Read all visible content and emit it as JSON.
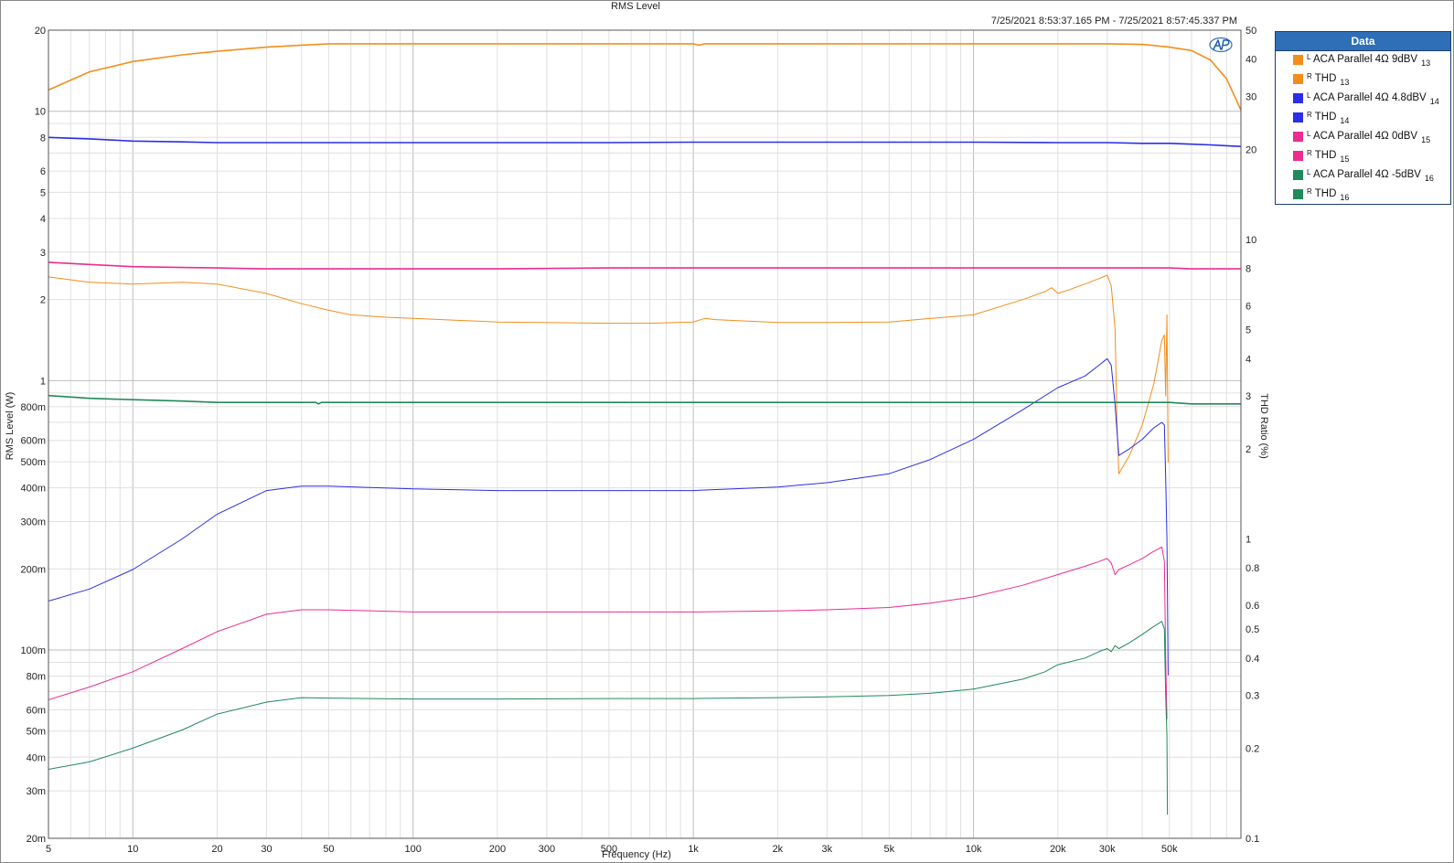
{
  "chart_data": {
    "type": "line",
    "title": "RMS Level",
    "subtitle": "7/25/2021 8:53:37.165 PM - 7/25/2021 8:57:45.337 PM",
    "xlabel": "Frequency (Hz)",
    "ylabel": "RMS Level (W)",
    "y2label": "THD Ratio (%)",
    "xscale": "log",
    "yscale": "log",
    "y2scale": "log",
    "xlim": [
      5,
      90000
    ],
    "ylim": [
      0.02,
      20
    ],
    "y2lim": [
      0.1,
      50
    ],
    "grid": true,
    "legend_position": "right",
    "x_tick_labels": [
      "5",
      "10",
      "20",
      "30",
      "50",
      "100",
      "200",
      "300",
      "500",
      "1k",
      "2k",
      "3k",
      "5k",
      "10k",
      "20k",
      "30k",
      "50k"
    ],
    "x_tick_values": [
      5,
      10,
      20,
      30,
      50,
      100,
      200,
      300,
      500,
      1000,
      2000,
      3000,
      5000,
      10000,
      20000,
      30000,
      50000
    ],
    "y_tick_labels": [
      "20",
      "10",
      "8",
      "6",
      "5",
      "4",
      "3",
      "2",
      "1",
      "800m",
      "600m",
      "500m",
      "400m",
      "300m",
      "200m",
      "100m",
      "80m",
      "60m",
      "50m",
      "40m",
      "30m",
      "20m"
    ],
    "y_tick_values": [
      20,
      10,
      8,
      6,
      5,
      4,
      3,
      2,
      1,
      0.8,
      0.6,
      0.5,
      0.4,
      0.3,
      0.2,
      0.1,
      0.08,
      0.06,
      0.05,
      0.04,
      0.03,
      0.02
    ],
    "y2_tick_labels": [
      "50",
      "40",
      "30",
      "20",
      "10",
      "8",
      "6",
      "5",
      "4",
      "3",
      "2",
      "1",
      "0.8",
      "0.6",
      "0.5",
      "0.4",
      "0.3",
      "0.2",
      "0.1"
    ],
    "y2_tick_values": [
      50,
      40,
      30,
      20,
      10,
      8,
      6,
      5,
      4,
      3,
      2,
      1,
      0.8,
      0.6,
      0.5,
      0.4,
      0.3,
      0.2,
      0.1
    ],
    "legend_title": "Data",
    "series": [
      {
        "name": "ACA Parallel 4Ω 9dBV",
        "channel": "L",
        "index": "13",
        "color": "#f28e1c",
        "axis": "left",
        "width": 1.6,
        "x": [
          5,
          7,
          10,
          15,
          20,
          30,
          40,
          50,
          100,
          200,
          500,
          1000,
          1050,
          1100,
          2000,
          5000,
          10000,
          20000,
          30000,
          40000,
          45000,
          50000,
          60000,
          70000,
          80000,
          90000
        ],
        "y": [
          12.0,
          14.0,
          15.3,
          16.2,
          16.7,
          17.3,
          17.6,
          17.8,
          17.8,
          17.8,
          17.8,
          17.8,
          17.6,
          17.8,
          17.8,
          17.8,
          17.8,
          17.8,
          17.8,
          17.7,
          17.5,
          17.3,
          16.8,
          15.5,
          13.2,
          10.1
        ]
      },
      {
        "name": "THD",
        "channel": "R",
        "index": "13",
        "color": "#f28e1c",
        "axis": "right",
        "width": 1.0,
        "x": [
          5,
          7,
          10,
          15,
          20,
          30,
          40,
          50,
          60,
          80,
          100,
          200,
          500,
          700,
          1000,
          1100,
          1200,
          2000,
          3000,
          5000,
          10000,
          15000,
          18000,
          19000,
          20000,
          22000,
          25000,
          28000,
          30000,
          31000,
          32000,
          32500,
          33000,
          36000,
          40000,
          44000,
          47000,
          48000,
          48500,
          49000,
          49500
        ],
        "y": [
          7.5,
          7.2,
          7.1,
          7.2,
          7.1,
          6.6,
          6.1,
          5.8,
          5.6,
          5.5,
          5.45,
          5.3,
          5.25,
          5.25,
          5.3,
          5.45,
          5.4,
          5.28,
          5.28,
          5.3,
          5.6,
          6.3,
          6.7,
          6.9,
          6.6,
          6.8,
          7.1,
          7.4,
          7.6,
          7.0,
          5.0,
          2.5,
          1.65,
          1.9,
          2.4,
          3.3,
          4.6,
          4.8,
          3.0,
          5.6,
          1.8
        ]
      },
      {
        "name": "ACA Parallel 4Ω 4.8dBV",
        "channel": "L",
        "index": "14",
        "color": "#2b2ee6",
        "axis": "left",
        "width": 1.6,
        "x": [
          5,
          7,
          10,
          15,
          20,
          30,
          50,
          100,
          200,
          500,
          1000,
          2000,
          5000,
          10000,
          20000,
          30000,
          40000,
          50000,
          60000,
          70000,
          80000,
          90000
        ],
        "y": [
          8.0,
          7.9,
          7.75,
          7.7,
          7.65,
          7.65,
          7.65,
          7.65,
          7.65,
          7.65,
          7.68,
          7.68,
          7.68,
          7.68,
          7.65,
          7.65,
          7.6,
          7.6,
          7.55,
          7.5,
          7.45,
          7.4
        ]
      },
      {
        "name": "THD",
        "channel": "R",
        "index": "14",
        "color": "#2b2ee6",
        "axis": "right",
        "width": 1.0,
        "x": [
          5,
          7,
          10,
          15,
          20,
          30,
          40,
          50,
          100,
          200,
          500,
          1000,
          2000,
          3000,
          5000,
          7000,
          10000,
          15000,
          20000,
          25000,
          28000,
          30000,
          31000,
          32000,
          32500,
          33000,
          36000,
          40000,
          44000,
          47000,
          48000,
          48500,
          49000,
          49500
        ],
        "y": [
          0.62,
          0.68,
          0.79,
          1.0,
          1.21,
          1.45,
          1.5,
          1.5,
          1.47,
          1.45,
          1.45,
          1.45,
          1.49,
          1.54,
          1.65,
          1.84,
          2.15,
          2.7,
          3.2,
          3.5,
          3.8,
          4.0,
          3.8,
          2.8,
          2.3,
          1.9,
          2.0,
          2.15,
          2.35,
          2.45,
          2.4,
          1.6,
          1.0,
          0.35
        ]
      },
      {
        "name": "ACA Parallel 4Ω 0dBV",
        "channel": "L",
        "index": "15",
        "color": "#ec2c8f",
        "axis": "left",
        "width": 1.6,
        "x": [
          5,
          7,
          10,
          15,
          20,
          30,
          50,
          100,
          200,
          500,
          1000,
          2000,
          5000,
          10000,
          20000,
          30000,
          40000,
          50000,
          60000,
          70000,
          80000,
          90000
        ],
        "y": [
          2.75,
          2.7,
          2.65,
          2.63,
          2.62,
          2.6,
          2.6,
          2.6,
          2.6,
          2.62,
          2.62,
          2.62,
          2.62,
          2.62,
          2.62,
          2.62,
          2.62,
          2.62,
          2.6,
          2.6,
          2.6,
          2.6
        ]
      },
      {
        "name": "THD",
        "channel": "R",
        "index": "15",
        "color": "#ec2c8f",
        "axis": "right",
        "width": 1.0,
        "x": [
          5,
          7,
          10,
          15,
          20,
          30,
          40,
          50,
          100,
          200,
          500,
          1000,
          2000,
          3000,
          5000,
          7000,
          10000,
          15000,
          20000,
          25000,
          28000,
          30000,
          31000,
          32000,
          33000,
          36000,
          40000,
          44000,
          47000,
          48000,
          48500,
          49000
        ],
        "y": [
          0.29,
          0.32,
          0.36,
          0.43,
          0.49,
          0.56,
          0.58,
          0.58,
          0.57,
          0.57,
          0.57,
          0.57,
          0.575,
          0.58,
          0.59,
          0.61,
          0.64,
          0.7,
          0.76,
          0.81,
          0.84,
          0.86,
          0.83,
          0.76,
          0.79,
          0.82,
          0.86,
          0.91,
          0.94,
          0.84,
          0.4,
          0.25
        ]
      },
      {
        "name": "ACA Parallel 4Ω -5dBV",
        "channel": "L",
        "index": "16",
        "color": "#21895a",
        "axis": "left",
        "width": 1.6,
        "x": [
          5,
          7,
          10,
          15,
          20,
          30,
          45,
          46,
          47,
          50,
          100,
          200,
          500,
          1000,
          2000,
          5000,
          10000,
          20000,
          30000,
          40000,
          50000,
          60000,
          70000,
          80000,
          90000
        ],
        "y": [
          0.88,
          0.86,
          0.85,
          0.84,
          0.83,
          0.83,
          0.83,
          0.82,
          0.83,
          0.83,
          0.83,
          0.83,
          0.83,
          0.83,
          0.83,
          0.83,
          0.83,
          0.83,
          0.83,
          0.83,
          0.83,
          0.82,
          0.82,
          0.82,
          0.82
        ]
      },
      {
        "name": "THD",
        "channel": "R",
        "index": "16",
        "color": "#21895a",
        "axis": "right",
        "width": 1.0,
        "x": [
          5,
          7,
          10,
          15,
          20,
          30,
          40,
          50,
          100,
          200,
          500,
          1000,
          2000,
          3000,
          5000,
          7000,
          10000,
          15000,
          18000,
          20000,
          25000,
          28000,
          30000,
          31000,
          32000,
          33000,
          36000,
          40000,
          44000,
          47000,
          48000,
          48500,
          49000,
          49200
        ],
        "y": [
          0.17,
          0.18,
          0.2,
          0.23,
          0.26,
          0.285,
          0.295,
          0.294,
          0.292,
          0.292,
          0.293,
          0.293,
          0.295,
          0.297,
          0.3,
          0.305,
          0.315,
          0.34,
          0.36,
          0.38,
          0.4,
          0.42,
          0.43,
          0.42,
          0.44,
          0.43,
          0.45,
          0.48,
          0.51,
          0.53,
          0.5,
          0.3,
          0.22,
          0.12
        ]
      }
    ]
  }
}
